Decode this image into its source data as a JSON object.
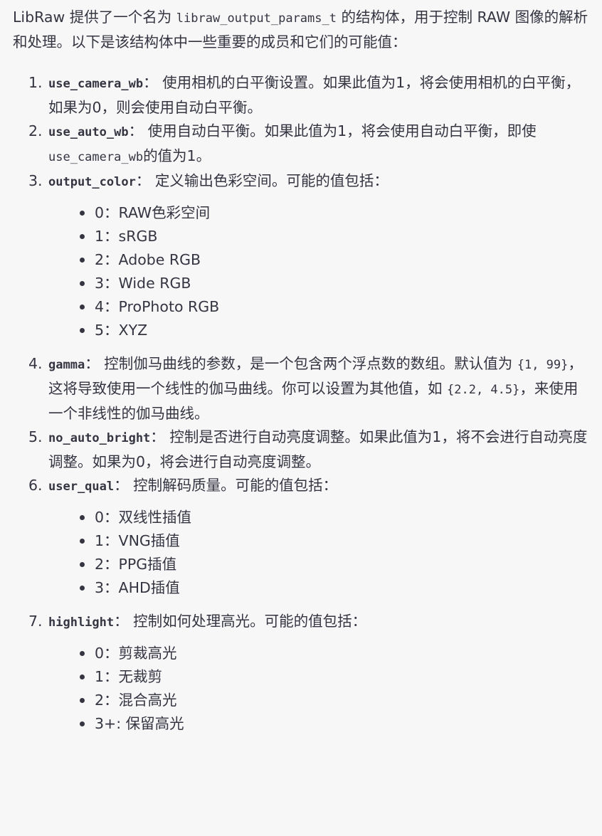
{
  "intro": {
    "part1": "LibRaw 提供了一个名为 ",
    "code": "libraw_output_params_t",
    "part2": " 的结构体，用于控制 RAW 图像的解析和处理。以下是该结构体中一些重要的成员和它们的可能值："
  },
  "params": [
    {
      "num": "1.",
      "name": "use_camera_wb",
      "sep": "：",
      "desc": " 使用相机的白平衡设置。如果此值为1，将会使用相机的白平衡，如果为0，则会使用自动白平衡。"
    },
    {
      "num": "2.",
      "name": "use_auto_wb",
      "sep": "：",
      "desc1": " 使用自动白平衡。如果此值为1，将会使用自动白平衡，即使",
      "code": "use_camera_wb",
      "desc2": "的值为1。"
    },
    {
      "num": "3.",
      "name": "output_color",
      "sep": "：",
      "desc": " 定义输出色彩空间。可能的值包括：",
      "values": [
        "0：RAW色彩空间",
        "1：sRGB",
        "2：Adobe RGB",
        "3：Wide RGB",
        "4：ProPhoto RGB",
        "5：XYZ"
      ]
    },
    {
      "num": "4.",
      "name": "gamma",
      "sep": "：",
      "desc1": " 控制伽马曲线的参数，是一个包含两个浮点数的数组。默认值为 ",
      "code1": "{1, 99}",
      "desc2": "，这将导致使用一个线性的伽马曲线。你可以设置为其他值，如 ",
      "code2": "{2.2, 4.5}",
      "desc3": "，来使用一个非线性的伽马曲线。"
    },
    {
      "num": "5.",
      "name": "no_auto_bright",
      "sep": "：",
      "desc": " 控制是否进行自动亮度调整。如果此值为1，将不会进行自动亮度调整。如果为0，将会进行自动亮度调整。"
    },
    {
      "num": "6.",
      "name": "user_qual",
      "sep": "：",
      "desc": " 控制解码质量。可能的值包括：",
      "values": [
        "0：双线性插值",
        "1：VNG插值",
        "2：PPG插值",
        "3：AHD插值"
      ]
    },
    {
      "num": "7.",
      "name": "highlight",
      "sep": "：",
      "desc": " 控制如何处理高光。可能的值包括：",
      "values": [
        "0：剪裁高光",
        "1：无裁剪",
        "2：混合高光",
        "3+: 保留高光"
      ]
    }
  ]
}
